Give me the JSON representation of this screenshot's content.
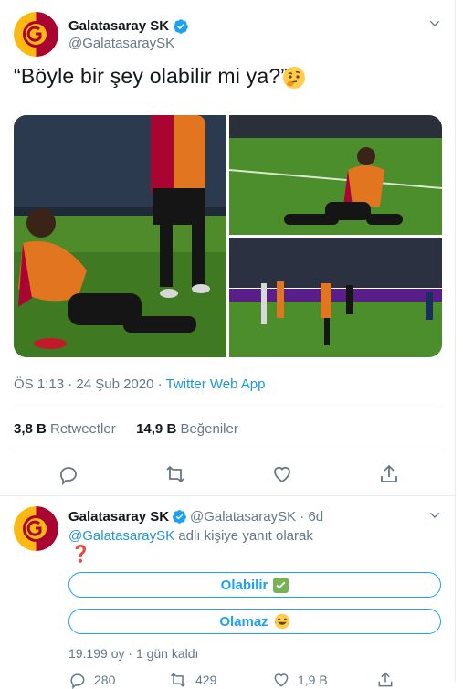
{
  "tweet": {
    "author_name": "Galatasaray SK",
    "author_handle": "@GalatasaraySK",
    "text": "“Böyle bir şey olabilir mi ya?”",
    "timestamp": "ÖS 1:13 · 24 Şub 2020",
    "meta_separator": " · ",
    "source": "Twitter Web App",
    "retweets_count": "3,8 B",
    "retweets_label": "Retweetler",
    "likes_count": "14,9 B",
    "likes_label": "Beğeniler"
  },
  "reply": {
    "author_name": "Galatasaray SK",
    "author_handle": "@GalatasaraySK",
    "age": "· 6d",
    "reply_to_handle": "@GalatasaraySK",
    "reply_to_suffix": " adlı kişiye yanıt olarak",
    "question_mark": "❓",
    "poll_options": [
      {
        "label": "Olabilir",
        "emoji": "✅"
      },
      {
        "label": "Olamaz",
        "emoji": "😂"
      }
    ],
    "poll_meta": "19.199 oy · 1 gün kaldı",
    "reply_count": "280",
    "retweet_count": "429",
    "like_count": "1,9 B"
  },
  "colors": {
    "accent": "#1da1f2",
    "text_secondary": "#657786",
    "galatasaray_red": "#a90432",
    "galatasaray_yellow": "#fdb912"
  },
  "icons": {
    "verified": "verified-badge-icon",
    "chevron": "chevron-down-icon",
    "reply": "reply-icon",
    "retweet": "retweet-icon",
    "like": "heart-icon",
    "share": "share-icon",
    "emoji": "thinking-face-emoji"
  }
}
